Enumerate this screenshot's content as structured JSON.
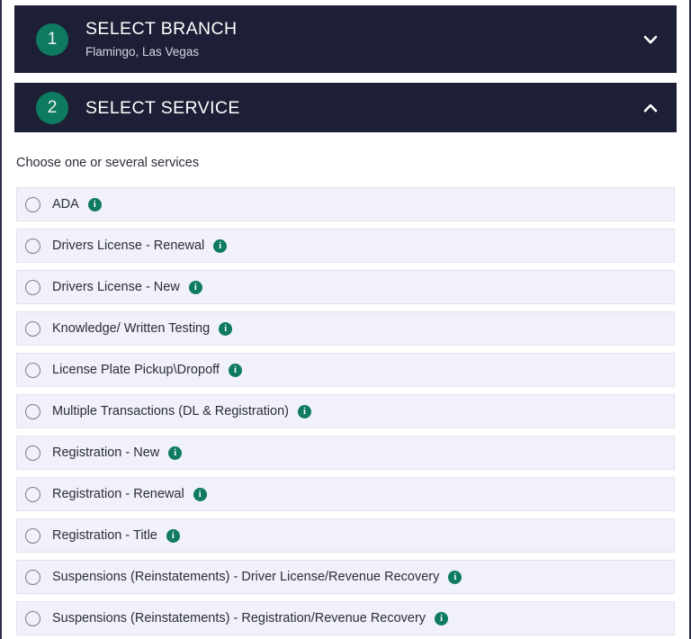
{
  "steps": [
    {
      "number": "1",
      "title": "SELECT BRANCH",
      "subtitle": "Flamingo, Las Vegas",
      "chevron": "chevron-down-icon",
      "expanded": false
    },
    {
      "number": "2",
      "title": "SELECT SERVICE",
      "subtitle": "",
      "chevron": "chevron-up-icon",
      "expanded": true
    }
  ],
  "service_section": {
    "instruction": "Choose one or several services",
    "info_icon_glyph": "i",
    "services": [
      {
        "label": "ADA",
        "selected": false
      },
      {
        "label": "Drivers License - Renewal",
        "selected": false
      },
      {
        "label": "Drivers License - New",
        "selected": false
      },
      {
        "label": "Knowledge/ Written Testing",
        "selected": false
      },
      {
        "label": "License Plate Pickup\\Dropoff",
        "selected": false
      },
      {
        "label": "Multiple Transactions (DL & Registration)",
        "selected": false
      },
      {
        "label": "Registration - New",
        "selected": false
      },
      {
        "label": "Registration - Renewal",
        "selected": false
      },
      {
        "label": "Registration - Title",
        "selected": false
      },
      {
        "label": "Suspensions (Reinstatements) - Driver License/Revenue Recovery",
        "selected": false
      },
      {
        "label": "Suspensions (Reinstatements) - Registration/Revenue Recovery",
        "selected": false
      }
    ]
  },
  "colors": {
    "header_bg": "#1c1f35",
    "accent_green": "#0e7a5f",
    "row_bg": "#f1f1fb",
    "row_border": "#e2e2ee",
    "page_border": "#2b2f4c",
    "text_dark": "#2b2d3a"
  }
}
